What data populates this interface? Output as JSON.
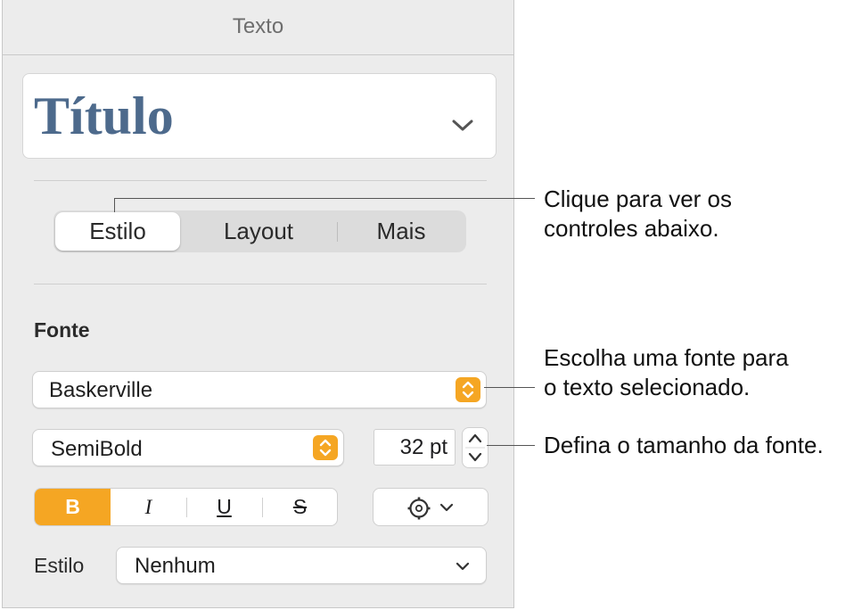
{
  "panel": {
    "title": "Texto",
    "paragraph_style": "Título",
    "tabs": [
      {
        "label": "Estilo",
        "active": true
      },
      {
        "label": "Layout",
        "active": false
      },
      {
        "label": "Mais",
        "active": false
      }
    ],
    "font_section_label": "Fonte",
    "font_family": "Baskerville",
    "font_typeface": "SemiBold",
    "font_size": "32 pt",
    "format_buttons": {
      "bold": "B",
      "italic": "I",
      "underline": "U",
      "strikethrough": "S"
    },
    "character_style_label": "Estilo",
    "character_style_value": "Nenhum"
  },
  "callouts": {
    "tabs_line1": "Clique para ver os",
    "tabs_line2": "controles abaixo.",
    "font_line1": "Escolha uma fonte para",
    "font_line2": "o texto selecionado.",
    "size_line1": "Defina o tamanho da fonte."
  },
  "colors": {
    "accent": "#f5a623",
    "title_blue": "#4d6a8c",
    "panel_bg": "#ececec"
  },
  "icons": [
    "chevron-down-icon",
    "popup-stepper-icon",
    "size-stepper-icon",
    "gear-icon"
  ]
}
